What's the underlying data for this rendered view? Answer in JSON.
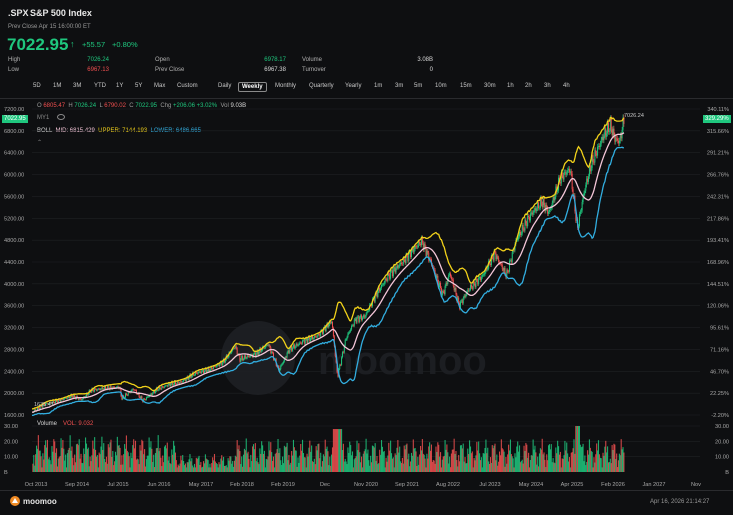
{
  "header": {
    "symbol": ".SPX",
    "name": "S&P 500 Index",
    "prev_close_time": "Prev Close Apr 15 16:00:00 ET",
    "price": "7022.95",
    "change": "+55.57",
    "change_pct": "+0.80%"
  },
  "quote": {
    "high_label": "High",
    "high": "7026.24",
    "low_label": "Low",
    "low": "6967.13",
    "open_label": "Open",
    "open": "6978.17",
    "prevclose_label": "Prev Close",
    "prevclose": "6967.38",
    "volume_label": "Volume",
    "volume": "3.08B",
    "turnover_label": "Turnover",
    "turnover": "0"
  },
  "tabs": [
    "5D",
    "1M",
    "3M",
    "YTD",
    "1Y",
    "5Y",
    "Max",
    "Custom",
    "Daily",
    "Weekly",
    "Monthly",
    "Quarterly",
    "Yearly",
    "1m",
    "3m",
    "5m",
    "10m",
    "15m",
    "30m",
    "1h",
    "2h",
    "3h",
    "4h"
  ],
  "active_tab": "Weekly",
  "ohlc": {
    "o_label": "O",
    "o": "6805.47",
    "h_label": "H",
    "h": "7026.24",
    "l_label": "L",
    "l": "6790.02",
    "c_label": "C",
    "c": "7022.95",
    "chg_label": "Chg",
    "chg": "+206.06",
    "chgp": "+3.02%",
    "vol_label": "Vol",
    "vol": "9.03B"
  },
  "my_label": "MY1",
  "boll": {
    "label": "BOLL",
    "mid": "MID: 6815.429",
    "upper": "UPPER: 7144.193",
    "lower": "LOWER: 6486.665"
  },
  "price_badge": "7022.95",
  "pct_badge": "329.29%",
  "high_marker": "7026.24",
  "low_marker": "1635.41",
  "volume_panel": {
    "title": "Volume",
    "vol": "VOL: 9.032"
  },
  "footer": {
    "brand": "moomoo",
    "timestamp": "Apr 16, 2026 21:14:27"
  },
  "colors": {
    "up": "#1fc77e",
    "down": "#f05050",
    "upper_band": "#f2d21a",
    "mid_band": "#f4c6d8",
    "lower_band": "#32aee0",
    "background": "#0e0f11"
  },
  "chart_data": {
    "type": "line",
    "y_left_ticks": [
      "7200.00",
      "6800.00",
      "6400.00",
      "6000.00",
      "5600.00",
      "5200.00",
      "4800.00",
      "4400.00",
      "4000.00",
      "3600.00",
      "3200.00",
      "2800.00",
      "2400.00",
      "2000.00",
      "1600.00"
    ],
    "y_right_ticks": [
      "340.11%",
      "315.66%",
      "291.21%",
      "266.76%",
      "242.31%",
      "217.86%",
      "193.41%",
      "168.96%",
      "144.51%",
      "120.06%",
      "95.61%",
      "71.16%",
      "46.70%",
      "22.25%",
      "-2.20%"
    ],
    "x_ticks": [
      "Oct 2013",
      "Sep 2014",
      "Jul 2015",
      "Jun 2016",
      "May 2017",
      "Feb 2018",
      "Feb 2019",
      "Dec",
      "Nov 2020",
      "Sep 2021",
      "Aug 2022",
      "Jul 2023",
      "May 2024",
      "Apr 2025",
      "Feb 2026",
      "Jan 2027",
      "Nov"
    ],
    "vol_ticks_left": [
      "30.00",
      "20.00",
      "10.00",
      "B"
    ],
    "vol_ticks_right": [
      "30.00",
      "20.00",
      "10.00",
      "B"
    ],
    "ylim": [
      1500,
      7300
    ],
    "x_range": [
      2013.75,
      2027.9
    ],
    "close": [
      [
        2013.75,
        1650
      ],
      [
        2014.0,
        1790
      ],
      [
        2014.3,
        1860
      ],
      [
        2014.6,
        1950
      ],
      [
        2014.8,
        1880
      ],
      [
        2015.0,
        2050
      ],
      [
        2015.3,
        2090
      ],
      [
        2015.6,
        2110
      ],
      [
        2015.65,
        1900
      ],
      [
        2015.9,
        2080
      ],
      [
        2016.1,
        1860
      ],
      [
        2016.4,
        2070
      ],
      [
        2016.7,
        2170
      ],
      [
        2016.9,
        2200
      ],
      [
        2017.2,
        2360
      ],
      [
        2017.5,
        2430
      ],
      [
        2017.8,
        2570
      ],
      [
        2018.05,
        2860
      ],
      [
        2018.15,
        2620
      ],
      [
        2018.5,
        2720
      ],
      [
        2018.75,
        2900
      ],
      [
        2018.98,
        2420
      ],
      [
        2019.2,
        2800
      ],
      [
        2019.5,
        2950
      ],
      [
        2019.8,
        3050
      ],
      [
        2020.1,
        3320
      ],
      [
        2020.22,
        2300
      ],
      [
        2020.4,
        3000
      ],
      [
        2020.6,
        3350
      ],
      [
        2020.8,
        3400
      ],
      [
        2021.0,
        3750
      ],
      [
        2021.3,
        4150
      ],
      [
        2021.6,
        4400
      ],
      [
        2021.8,
        4600
      ],
      [
        2022.0,
        4780
      ],
      [
        2022.2,
        4400
      ],
      [
        2022.45,
        3800
      ],
      [
        2022.6,
        4200
      ],
      [
        2022.8,
        3600
      ],
      [
        2023.0,
        3900
      ],
      [
        2023.3,
        4150
      ],
      [
        2023.55,
        4560
      ],
      [
        2023.8,
        4150
      ],
      [
        2024.0,
        4780
      ],
      [
        2024.3,
        5250
      ],
      [
        2024.55,
        5500
      ],
      [
        2024.7,
        5300
      ],
      [
        2024.95,
        5950
      ],
      [
        2025.15,
        6100
      ],
      [
        2025.3,
        5000
      ],
      [
        2025.45,
        5700
      ],
      [
        2025.6,
        6200
      ],
      [
        2025.85,
        6700
      ],
      [
        2026.0,
        6900
      ],
      [
        2026.1,
        6650
      ],
      [
        2026.2,
        6600
      ],
      [
        2026.29,
        7022.95
      ]
    ]
  }
}
